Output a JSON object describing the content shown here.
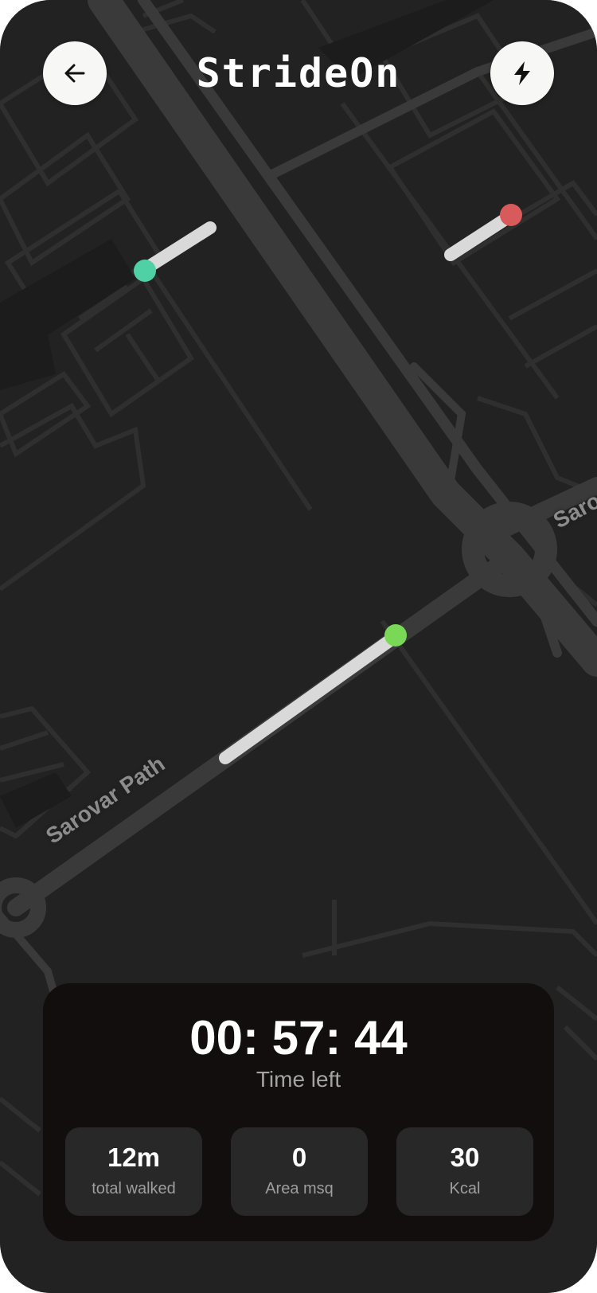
{
  "header": {
    "title": "StrideOn",
    "back_icon": "arrow-left-icon",
    "boost_icon": "lightning-bolt-icon"
  },
  "map": {
    "streets": [
      "Sarovar Path",
      "Saro"
    ],
    "colors": {
      "background": "#222222",
      "road": "#3a3a3a",
      "block_outline": "#2f2f2f",
      "trail": "#d9d9d9",
      "marker_start": "#4fd1a5",
      "marker_end": "#d95a5a",
      "marker_current": "#79d957"
    }
  },
  "stats_panel": {
    "timer": "00: 57: 44",
    "timer_label": "Time left",
    "stats": [
      {
        "value": "12m",
        "label": "total walked"
      },
      {
        "value": "0",
        "label": "Area msq"
      },
      {
        "value": "30",
        "label": "Kcal"
      }
    ]
  }
}
